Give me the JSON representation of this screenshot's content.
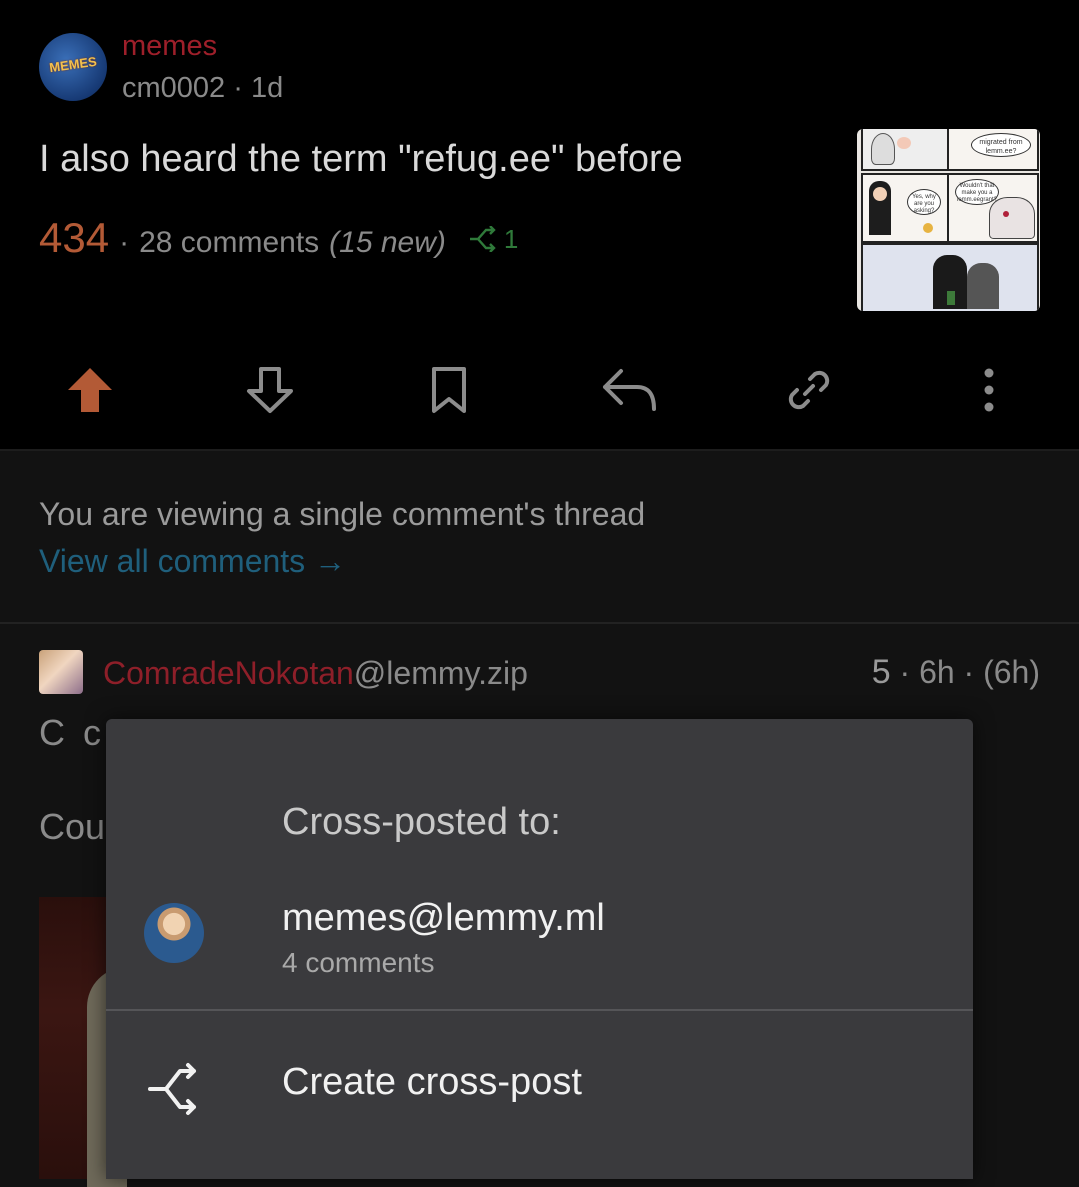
{
  "post": {
    "community": "memes",
    "community_logo_text": "MEMES",
    "author": "cm0002",
    "age": "1d",
    "title": "I also heard the term \"refug.ee\" before",
    "score": "434",
    "comments": "28 comments",
    "new_comments": "(15 new)",
    "crossposts": "1",
    "thumbnail_text": [
      "migrated from lemm.ee?",
      "Wouldn't that make you a lemm.eegrant?",
      "Yes, why are you asking?"
    ]
  },
  "actions": [
    "upvote-icon",
    "downvote-icon",
    "bookmark-icon",
    "reply-icon",
    "link-icon",
    "more-icon"
  ],
  "thread": {
    "note": "You are viewing a single comment's thread",
    "view_all": "View all comments →"
  },
  "comment": {
    "username": "ComradeNokotan",
    "instance": "@lemmy.zip",
    "score": "5",
    "age": "· 6h · (6h)",
    "body_line1": "C c c",
    "body_line2": "Cou"
  },
  "sheet": {
    "title": "Cross-posted to:",
    "crossposts": [
      {
        "name": "memes@lemmy.ml",
        "comments": "4 comments"
      }
    ],
    "create_label": "Create cross-post"
  },
  "colors": {
    "accent_upvote": "#b35a36",
    "community": "#9e1f2a",
    "link": "#1f5f7c",
    "crosspost_green": "#2f7a3a"
  }
}
